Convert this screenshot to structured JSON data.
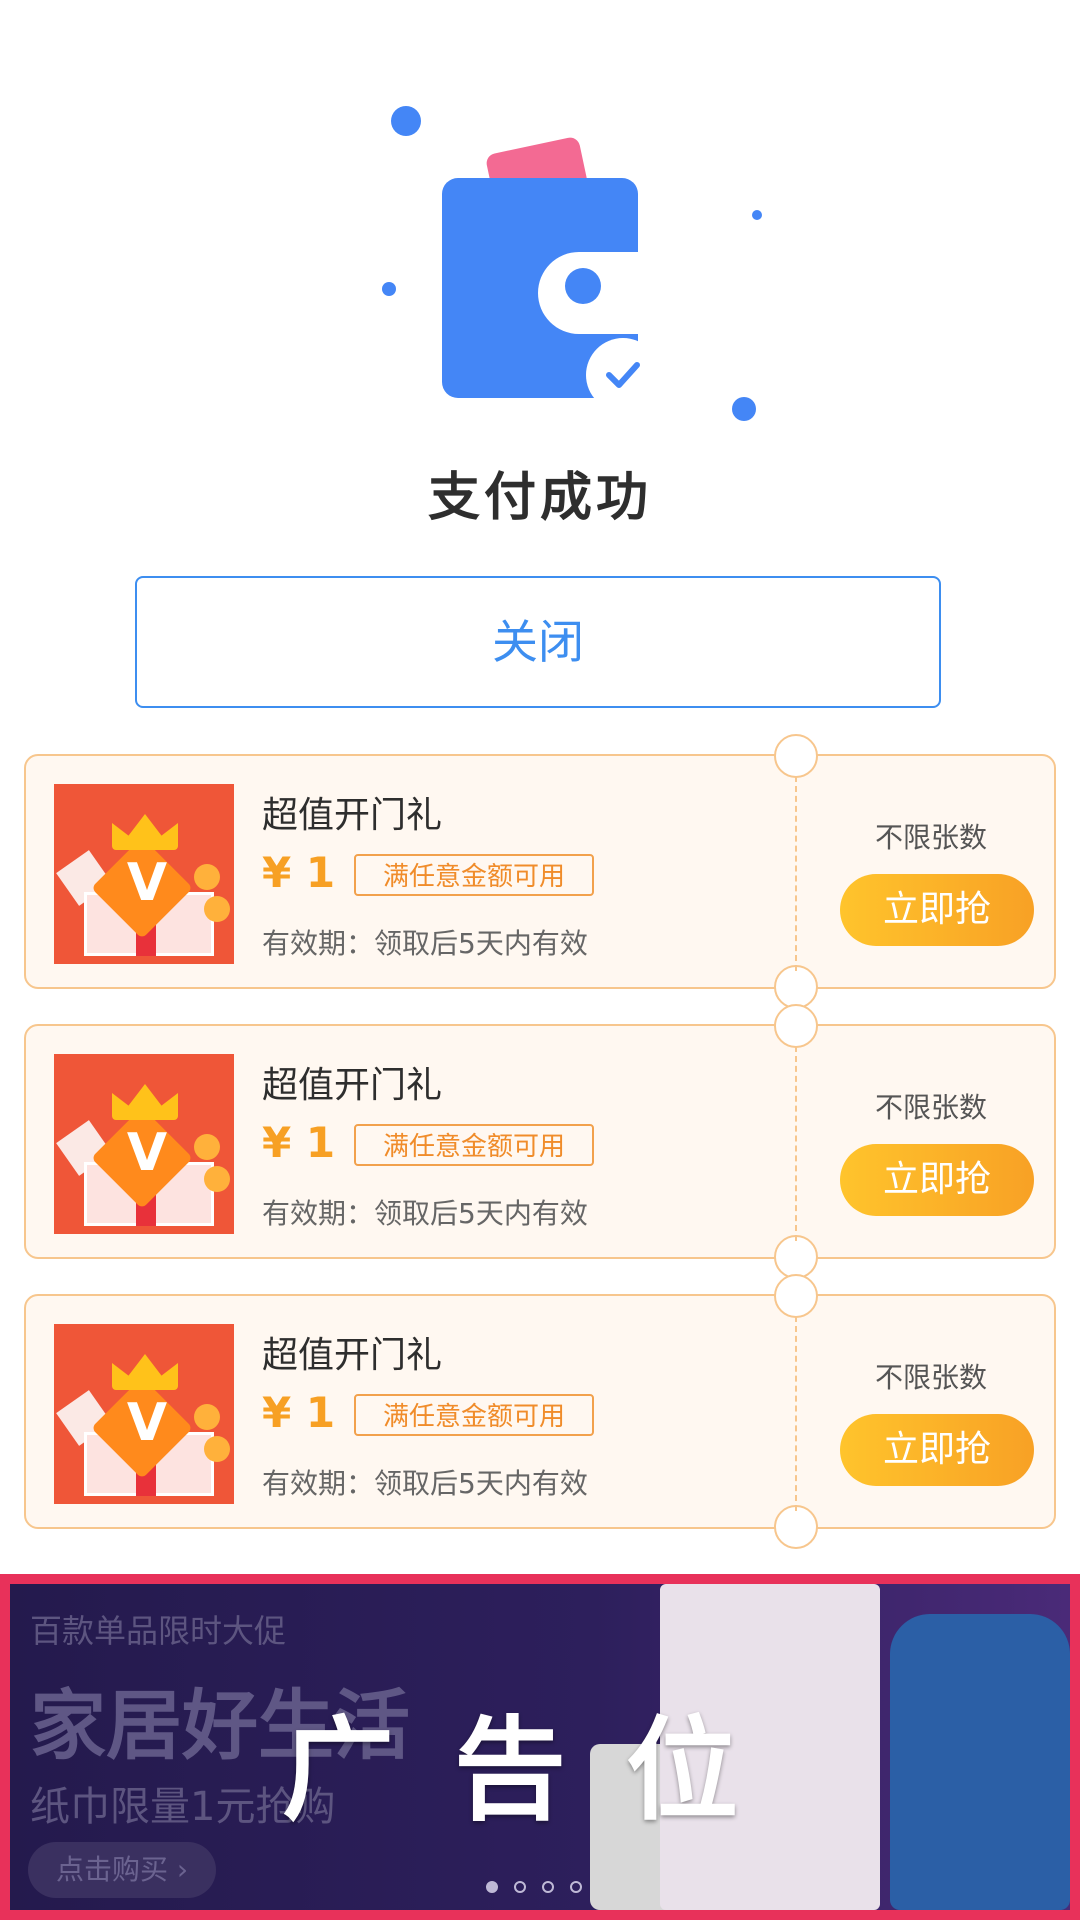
{
  "status": {
    "title": "支付成功"
  },
  "actions": {
    "close_label": "关闭"
  },
  "coupons": [
    {
      "title": "超值开门礼",
      "price": "¥ 1",
      "condition": "满任意金额可用",
      "validity": "有效期：领取后5天内有效",
      "limit": "不限张数",
      "button": "立即抢"
    },
    {
      "title": "超值开门礼",
      "price": "¥ 1",
      "condition": "满任意金额可用",
      "validity": "有效期：领取后5天内有效",
      "limit": "不限张数",
      "button": "立即抢"
    },
    {
      "title": "超值开门礼",
      "price": "¥ 1",
      "condition": "满任意金额可用",
      "validity": "有效期：领取后5天内有效",
      "limit": "不限张数",
      "button": "立即抢"
    }
  ],
  "ad": {
    "label": "广告位",
    "subheading": "百款单品限时大促",
    "headline": "家居好生活",
    "promo_line": "纸巾限量1元抢购",
    "buy_button": "点击购买 ›",
    "carousel_count": 4,
    "active_index": 0
  },
  "colors": {
    "primary_blue": "#4486f6",
    "accent_orange": "#f7a024",
    "ad_border": "#e8315a"
  },
  "icons": {
    "wallet": "wallet-icon",
    "check": "check-icon",
    "gift": "gift-icon"
  }
}
